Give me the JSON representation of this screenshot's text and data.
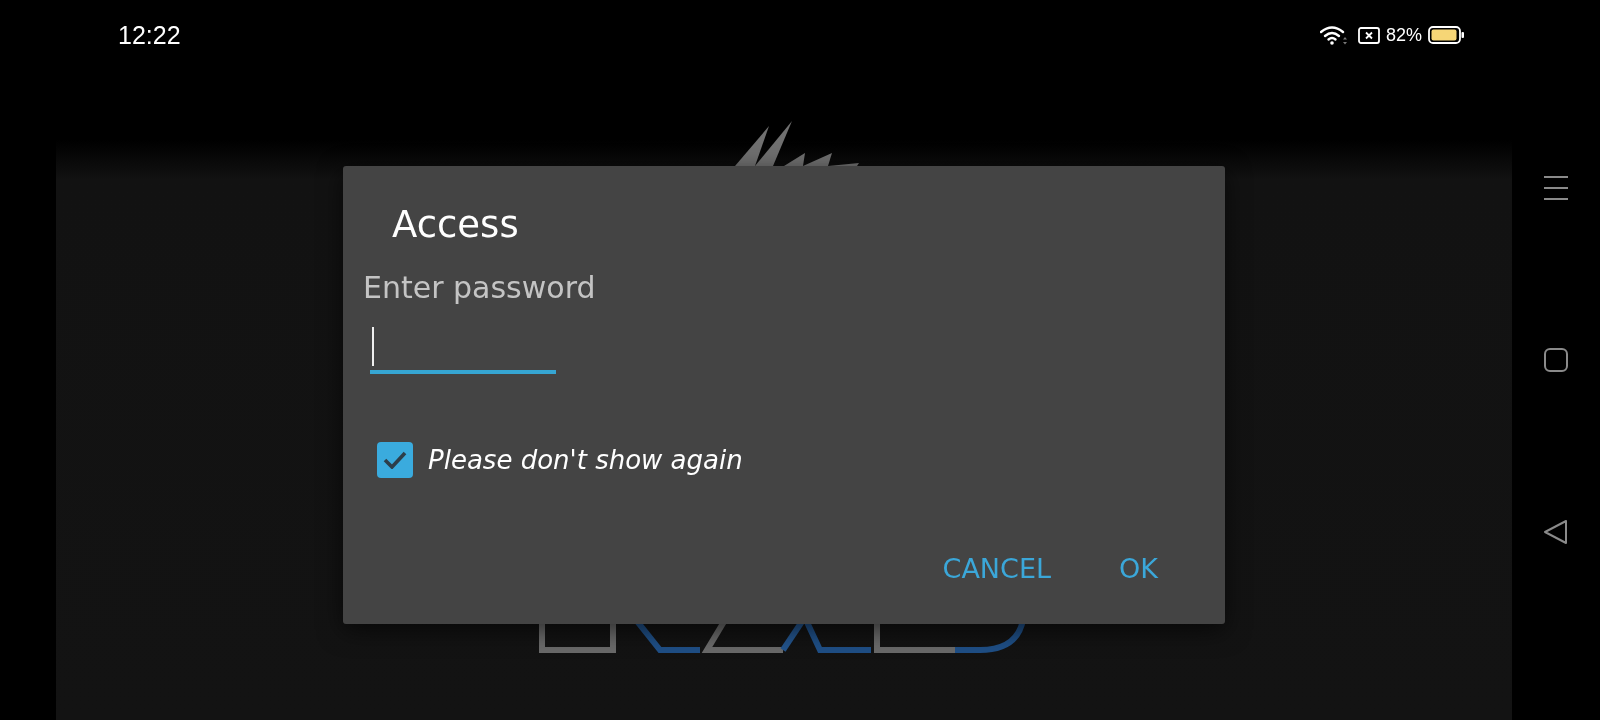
{
  "status_bar": {
    "time": "12:22",
    "battery": "82%"
  },
  "dialog": {
    "title": "Access",
    "message": "Enter password",
    "password_field": {
      "focused": true
    },
    "checkbox": {
      "label": "Please don't show again",
      "checked": true
    },
    "buttons": [
      {
        "label": "CANCEL"
      },
      {
        "label": "OK"
      }
    ]
  }
}
